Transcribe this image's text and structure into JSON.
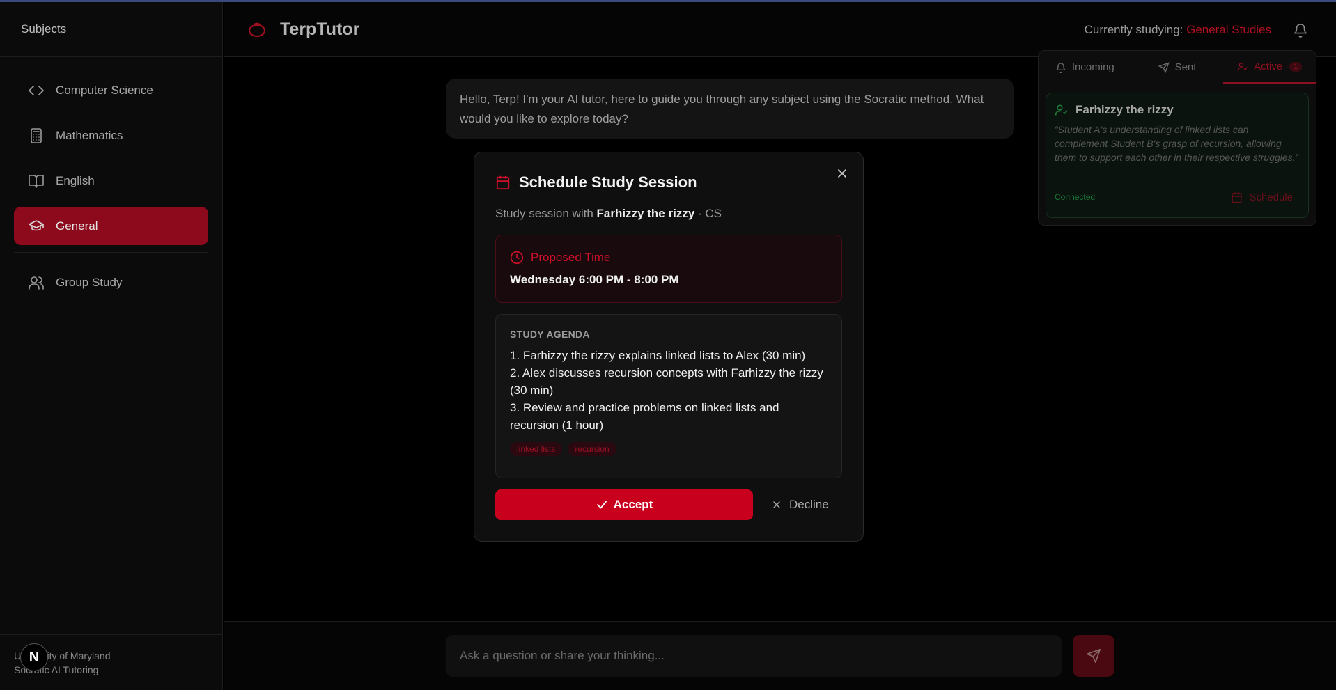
{
  "sidebar": {
    "title": "Subjects",
    "items": [
      {
        "label": "Computer Science",
        "icon": "code-icon"
      },
      {
        "label": "Mathematics",
        "icon": "calculator-icon"
      },
      {
        "label": "English",
        "icon": "book-icon"
      },
      {
        "label": "General",
        "icon": "graduation-cap-icon",
        "active": true
      },
      {
        "label": "Group Study",
        "icon": "users-icon"
      }
    ],
    "footer_line1": "University of Maryland",
    "footer_line2": "Socratic AI Tutoring",
    "badge": "N"
  },
  "header": {
    "app_title": "TerpTutor",
    "studying_label": "Currently studying: ",
    "studying_subject": "General Studies"
  },
  "chat": {
    "greeting": "Hello, Terp! I'm your AI tutor, here to guide you through any subject using the Socratic method. What would you like to explore today?",
    "input_placeholder": "Ask a question or share your thinking..."
  },
  "panel": {
    "tabs": [
      {
        "label": "Incoming"
      },
      {
        "label": "Sent"
      },
      {
        "label": "Active",
        "count": "1",
        "active": true
      }
    ],
    "match": {
      "name": "Farhizzy the rizzy",
      "quote": "“Student A's understanding of linked lists can complement Student B's grasp of recursion, allowing them to support each other in their respective struggles.”",
      "status": "Connected",
      "schedule_label": "Schedule"
    }
  },
  "modal": {
    "title": "Schedule Study Session",
    "sub_prefix": "Study session with ",
    "partner": "Farhizzy the rizzy",
    "sub_suffix": " · CS",
    "proposed_label": "Proposed Time",
    "proposed_time": "Wednesday 6:00 PM - 8:00 PM",
    "agenda_head": "STUDY AGENDA",
    "agenda": [
      "1. Farhizzy the rizzy explains linked lists to Alex (30 min)",
      "2. Alex discusses recursion concepts with Farhizzy the rizzy (30 min)",
      "3. Review and practice problems on linked lists and recursion (1 hour)"
    ],
    "tags": [
      "linked lists",
      "recursion"
    ],
    "accept_label": "Accept",
    "decline_label": "Decline"
  },
  "colors": {
    "accent": "#c8001e",
    "active_nav": "#8d0a1c",
    "connected_green": "#1c7a3a"
  }
}
